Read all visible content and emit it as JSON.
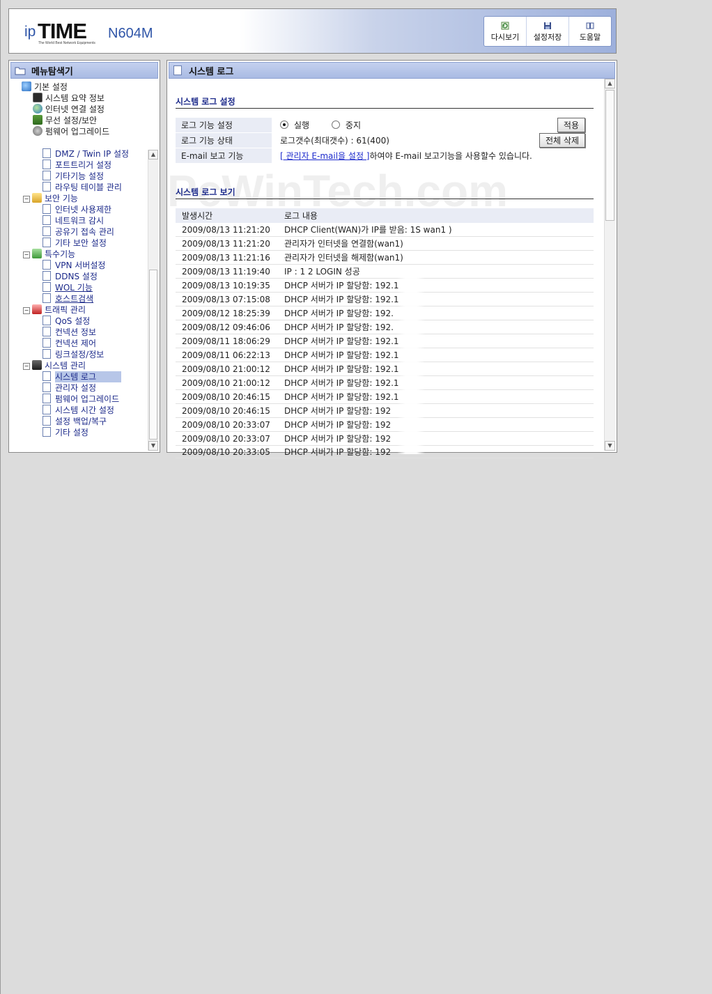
{
  "header": {
    "logo_ip": "ip",
    "logo_time": "TIME",
    "logo_tagline": "The World Best Network Equipments",
    "model": "N604M",
    "toolbar": [
      {
        "label": "다시보기",
        "icon": "refresh-icon"
      },
      {
        "label": "설정저장",
        "icon": "save-icon"
      },
      {
        "label": "도움말",
        "icon": "help-book-icon"
      }
    ]
  },
  "sidebar": {
    "title": "메뉴탐색기",
    "tree": [
      {
        "label": "기본 설정",
        "level": 0,
        "kind": "group",
        "icon": "globe-folder-icon"
      },
      {
        "label": "시스템 요약 정보",
        "level": 1,
        "kind": "item",
        "icon": "monitor-icon"
      },
      {
        "label": "인터넷 연결 설정",
        "level": 1,
        "kind": "item",
        "icon": "globe-icon"
      },
      {
        "label": "무선 설정/보안",
        "level": 1,
        "kind": "item",
        "icon": "antenna-icon"
      },
      {
        "label": "펌웨어 업그레이드",
        "level": 1,
        "kind": "item",
        "icon": "gear-icon"
      },
      {
        "label": "DMZ / Twin IP 설정",
        "level": 2,
        "kind": "page"
      },
      {
        "label": "포트트리거 설정",
        "level": 2,
        "kind": "page"
      },
      {
        "label": "기타기능 설정",
        "level": 2,
        "kind": "page"
      },
      {
        "label": "라우팅 테이블 관리",
        "level": 2,
        "kind": "page"
      },
      {
        "label": "보안 기능",
        "level": 1,
        "kind": "group",
        "icon": "lock-folder-icon"
      },
      {
        "label": "인터넷 사용제한",
        "level": 2,
        "kind": "page"
      },
      {
        "label": "네트워크 감시",
        "level": 2,
        "kind": "page"
      },
      {
        "label": "공유기 접속 관리",
        "level": 2,
        "kind": "page"
      },
      {
        "label": "기타 보안 설정",
        "level": 2,
        "kind": "page"
      },
      {
        "label": "특수기능",
        "level": 1,
        "kind": "group",
        "icon": "star-folder-icon"
      },
      {
        "label": "VPN 서버설정",
        "level": 2,
        "kind": "page"
      },
      {
        "label": "DDNS 설정",
        "level": 2,
        "kind": "page"
      },
      {
        "label": "WOL 기능",
        "level": 2,
        "kind": "page",
        "underline": true
      },
      {
        "label": "호스트검색",
        "level": 2,
        "kind": "page",
        "underline": true
      },
      {
        "label": "트래픽 관리",
        "level": 1,
        "kind": "group",
        "icon": "traffic-icon"
      },
      {
        "label": "QoS 설정",
        "level": 2,
        "kind": "page"
      },
      {
        "label": "컨넥션 정보",
        "level": 2,
        "kind": "page"
      },
      {
        "label": "컨넥션 제어",
        "level": 2,
        "kind": "page"
      },
      {
        "label": "링크설정/정보",
        "level": 2,
        "kind": "page"
      },
      {
        "label": "시스템 관리",
        "level": 1,
        "kind": "group",
        "icon": "system-icon"
      },
      {
        "label": "시스템 로그",
        "level": 2,
        "kind": "page",
        "selected": true
      },
      {
        "label": "관리자 설정",
        "level": 2,
        "kind": "page"
      },
      {
        "label": "펌웨어 업그레이드",
        "level": 2,
        "kind": "page"
      },
      {
        "label": "시스템 시간 설정",
        "level": 2,
        "kind": "page"
      },
      {
        "label": "설정 백업/복구",
        "level": 2,
        "kind": "page"
      },
      {
        "label": "기타 설정",
        "level": 2,
        "kind": "page"
      }
    ]
  },
  "main": {
    "title": "시스템 로그",
    "watermark": "PcWinTech.com",
    "settings": {
      "title": "시스템 로그 설정",
      "row_function_label": "로그 기능 설정",
      "opt_run": "실행",
      "opt_stop": "중지",
      "apply_label": "적용",
      "row_status_label": "로그 기능 상태",
      "status_value": "로그갯수(최대갯수) : 61(400)",
      "clear_all_label": "전체 삭제",
      "row_email_label": "E-mail 보고 기능",
      "email_link": "[ 관리자 E-mail을 설정 ]",
      "email_text": "하여야 E-mail 보고기능을 사용할수 있습니다."
    },
    "log": {
      "title": "시스템 로그 보기",
      "col_time": "발생시간",
      "col_content": "로그 내용",
      "rows": [
        {
          "time": "2009/08/13 11:21:20",
          "content": "DHCP Client(WAN)가 IP를 받음: 1S                      wan1 )"
        },
        {
          "time": "2009/08/13 11:21:20",
          "content": "관리자가 인터넷을 연결함(wan1)"
        },
        {
          "time": "2009/08/13 11:21:16",
          "content": "관리자가 인터넷을 해제함(wan1)"
        },
        {
          "time": "2009/08/13 11:19:40",
          "content": "IP : 1               2 LOGIN 성공"
        },
        {
          "time": "2009/08/13 10:19:35",
          "content": "DHCP 서버가 IP 할당함: 192.1"
        },
        {
          "time": "2009/08/13 07:15:08",
          "content": "DHCP 서버가 IP 할당함: 192.1"
        },
        {
          "time": "2009/08/12 18:25:39",
          "content": "DHCP 서버가 IP 할당함: 192."
        },
        {
          "time": "2009/08/12 09:46:06",
          "content": "DHCP 서버가 IP 할당함: 192."
        },
        {
          "time": "2009/08/11 18:06:29",
          "content": "DHCP 서버가 IP 할당함: 192.1"
        },
        {
          "time": "2009/08/11 06:22:13",
          "content": "DHCP 서버가 IP 할당함: 192.1"
        },
        {
          "time": "2009/08/10 21:00:12",
          "content": "DHCP 서버가 IP 할당함: 192.1"
        },
        {
          "time": "2009/08/10 21:00:12",
          "content": "DHCP 서버가 IP 할당함: 192.1"
        },
        {
          "time": "2009/08/10 20:46:15",
          "content": "DHCP 서버가 IP 할당함: 192.1"
        },
        {
          "time": "2009/08/10 20:46:15",
          "content": "DHCP 서버가 IP 할당함: 192"
        },
        {
          "time": "2009/08/10 20:33:07",
          "content": "DHCP 서버가 IP 할당함: 192"
        },
        {
          "time": "2009/08/10 20:33:07",
          "content": "DHCP 서버가 IP 할당함: 192"
        },
        {
          "time": "2009/08/10 20:33:05",
          "content": "DHCP 서버가 IP 할당함: 192"
        }
      ]
    }
  },
  "colors": {
    "accent": "#1c2a8a",
    "title_bar": "#b7c6e8",
    "page_bg": "#dcdcdc"
  }
}
